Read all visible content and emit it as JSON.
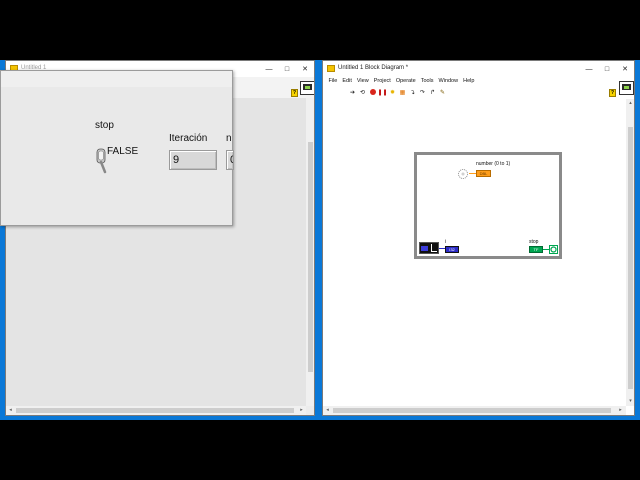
{
  "front_panel": {
    "title": "Untitled 1",
    "window_buttons": [
      "—",
      "□",
      "✕"
    ],
    "stop_label": "stop",
    "stop_state": "FALSE",
    "iteration_label": "Iteración",
    "iteration_value": "9",
    "number_label_partial": "n",
    "number_value_partial": "0"
  },
  "block_diagram": {
    "title": "Untitled 1 Block Diagram *",
    "window_buttons": [
      "—",
      "□",
      "✕"
    ],
    "menu": [
      "File",
      "Edit",
      "View",
      "Project",
      "Operate",
      "Tools",
      "Window",
      "Help"
    ],
    "toolbar_icons": [
      "run-arrow-icon",
      "run-continuously-icon",
      "abort-icon",
      "pause-icon",
      "highlight-execution-icon",
      "retain-wire-values-icon",
      "step-into-icon",
      "step-over-icon",
      "step-out-icon",
      "clean-diagram-icon"
    ],
    "random_number_label": "number (0 to 1)",
    "random_number_terminal": "DBL",
    "iteration_terminal_label": "i",
    "iteration_indicator": "I32",
    "stop_label": "stop",
    "stop_terminal": "TF"
  },
  "colors": {
    "desktop": "#0a78d7",
    "numeric_terminal": "#ff9e1b",
    "boolean_terminal": "#00a651",
    "integer_terminal": "#2b2bc7"
  }
}
